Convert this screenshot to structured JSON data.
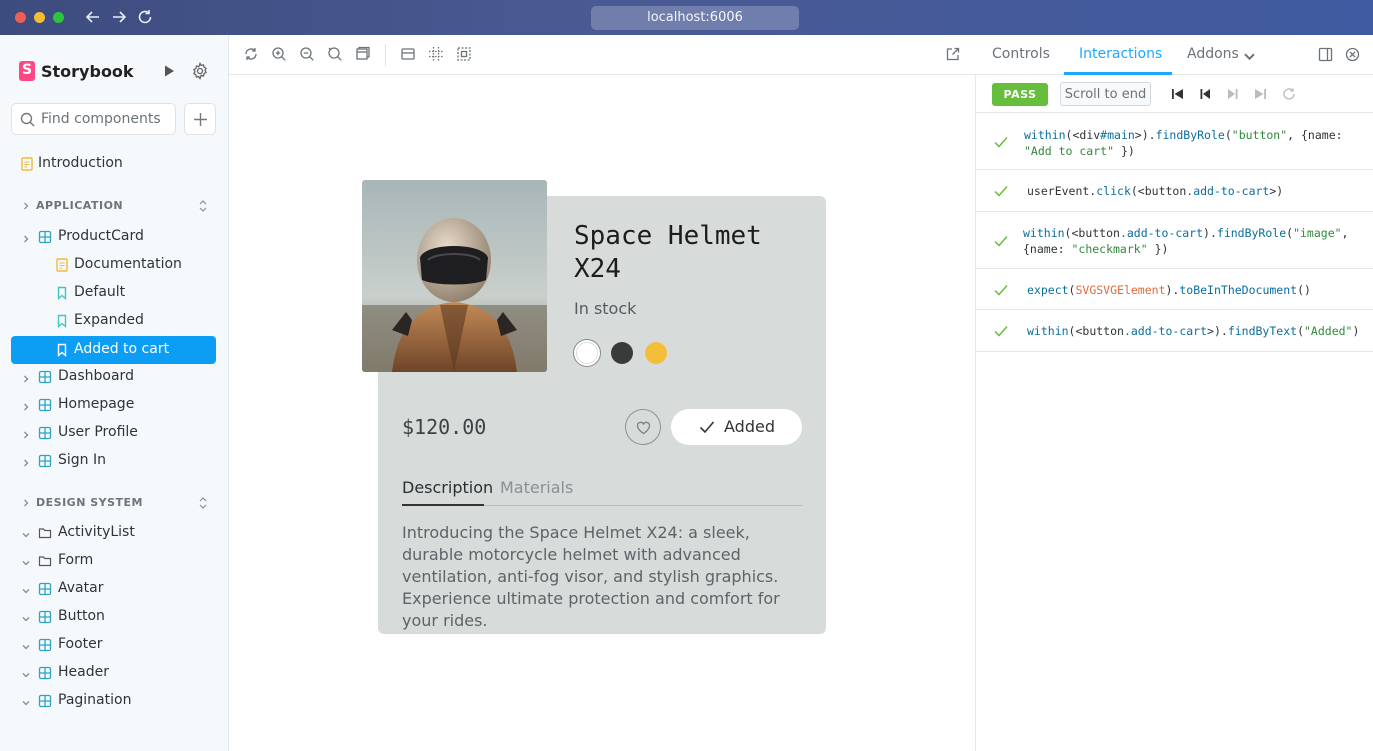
{
  "browser": {
    "url": "localhost:6006"
  },
  "sidebar": {
    "brand": "Storybook",
    "search_placeholder": "Find components",
    "introduction": "Introduction",
    "application_heading": "APPLICATION",
    "productcard": "ProductCard",
    "productcard_children": [
      "Documentation",
      "Default",
      "Expanded",
      "Added to cart"
    ],
    "application_items": [
      "Dashboard",
      "Homepage",
      "User Profile",
      "Sign In"
    ],
    "design_heading": "DESIGN SYSTEM",
    "design_items": [
      "ActivityList",
      "Form",
      "Avatar",
      "Button",
      "Footer",
      "Header",
      "Pagination"
    ]
  },
  "product": {
    "title": "Space Helmet X24",
    "stock": "In stock",
    "swatch_colors": [
      "#ffffff",
      "#3a3a3a",
      "#f3bf3a"
    ],
    "price": "$120.00",
    "added_label": "Added",
    "tab_description": "Description",
    "tab_materials": "Materials",
    "description": "Introducing the Space Helmet X24: a sleek, durable motorcycle helmet with advanced ventilation, anti-fog visor, and stylish graphics. Experience ultimate protection and comfort for your rides."
  },
  "panel": {
    "tabs": [
      "Controls",
      "Interactions",
      "Addons"
    ],
    "pass": "PASS",
    "scroll_to_end": "Scroll to end",
    "interactions": [
      "within(<div#main>).findByRole(\"button\", {name: \"Add to cart\" })",
      "userEvent.click(<button.add-to-cart>)",
      "within(<button.add-to-cart).findByRole(\"image\", {name: \"checkmark\" })",
      "expect(SVGSVGElement).toBeInTheDocument()",
      "within(<button.add-to-cart>).findByText(\"Added\")"
    ]
  },
  "colors": {
    "accent": "#1ea7fd",
    "selected": "#0c9ef5",
    "pass": "#66bf3c",
    "card": "#d7dcdb"
  }
}
